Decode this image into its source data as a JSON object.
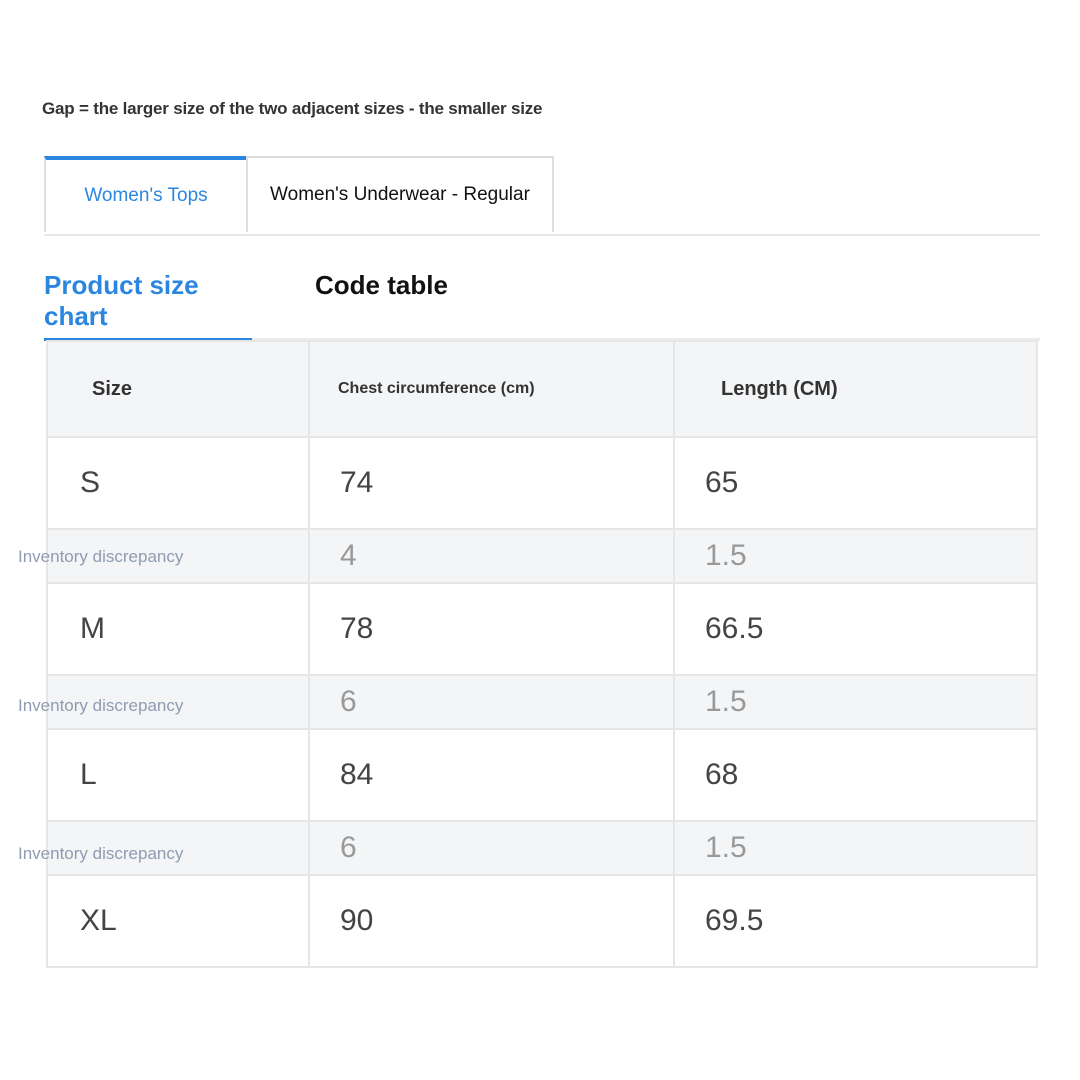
{
  "note": "Gap = the larger size of the two adjacent sizes - the smaller size",
  "tabs": [
    {
      "label": "Women's Tops",
      "active": true
    },
    {
      "label": "Women's Underwear - Regular",
      "active": false
    }
  ],
  "subtabs": [
    {
      "label": "Product size chart",
      "active": true
    },
    {
      "label": "Code table",
      "active": false
    }
  ],
  "table": {
    "headers": [
      "Size",
      "Chest circumference (cm)",
      "Length (CM)"
    ],
    "rows": [
      {
        "size": "S",
        "chest": "74",
        "length": "65"
      },
      {
        "gap_label": "Inventory discrepancy",
        "chest": "4",
        "length": "1.5"
      },
      {
        "size": "M",
        "chest": "78",
        "length": "66.5"
      },
      {
        "gap_label": "Inventory discrepancy",
        "chest": "6",
        "length": "1.5"
      },
      {
        "size": "L",
        "chest": "84",
        "length": "68"
      },
      {
        "gap_label": "Inventory discrepancy",
        "chest": "6",
        "length": "1.5"
      },
      {
        "size": "XL",
        "chest": "90",
        "length": "69.5"
      }
    ]
  },
  "colors": {
    "accent": "#2b86e0",
    "header_bg": "#f4f5f7",
    "gap_label": "#8f9bb0"
  }
}
